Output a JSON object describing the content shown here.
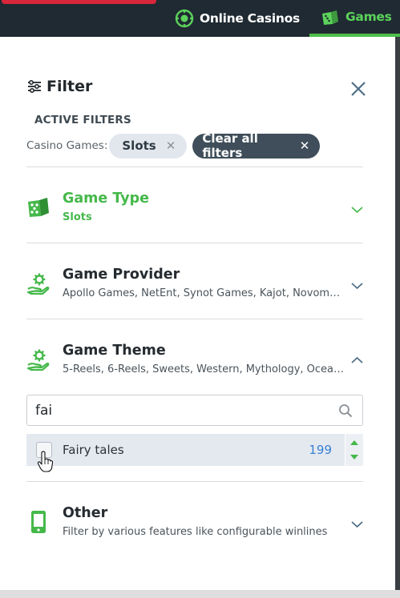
{
  "topnav": {
    "items": [
      {
        "label": "Online Casinos",
        "icon": "casino-chip-icon"
      },
      {
        "label": "Games",
        "icon": "dice-icon",
        "active": true
      }
    ]
  },
  "filter": {
    "title": "Filter",
    "active_filters_label": "ACTIVE FILTERS",
    "chip_prefix": "Casino Games:",
    "chips": [
      {
        "label": "Slots",
        "remove_icon": "x-icon"
      }
    ],
    "clear_all_label": "Clear all filters",
    "sections": [
      {
        "title": "Game Type",
        "subtitle": "Slots",
        "icon": "dice-icon",
        "expanded": false,
        "highlighted": true
      },
      {
        "title": "Game Provider",
        "subtitle": "Apollo Games, NetEnt, Synot Games, Kajot, Novomatic",
        "icon": "hand-gear-icon",
        "expanded": false
      },
      {
        "title": "Game Theme",
        "subtitle": "5-Reels, 6-Reels, Sweets, Western, Mythology, Ocean...",
        "icon": "hand-gear-icon",
        "expanded": true
      },
      {
        "title": "Other",
        "subtitle": "Filter by various features like configurable winlines",
        "icon": "phone-icon",
        "expanded": false
      }
    ],
    "theme_search": {
      "value": "fai",
      "placeholder": ""
    },
    "theme_options": [
      {
        "label": "Fairy tales",
        "count": "199",
        "checked": false
      }
    ]
  },
  "colors": {
    "accent_green": "#45b84a",
    "topbar": "#1f2a32",
    "count_blue": "#3b7fd4",
    "clear_chip": "#3f4e5a"
  }
}
